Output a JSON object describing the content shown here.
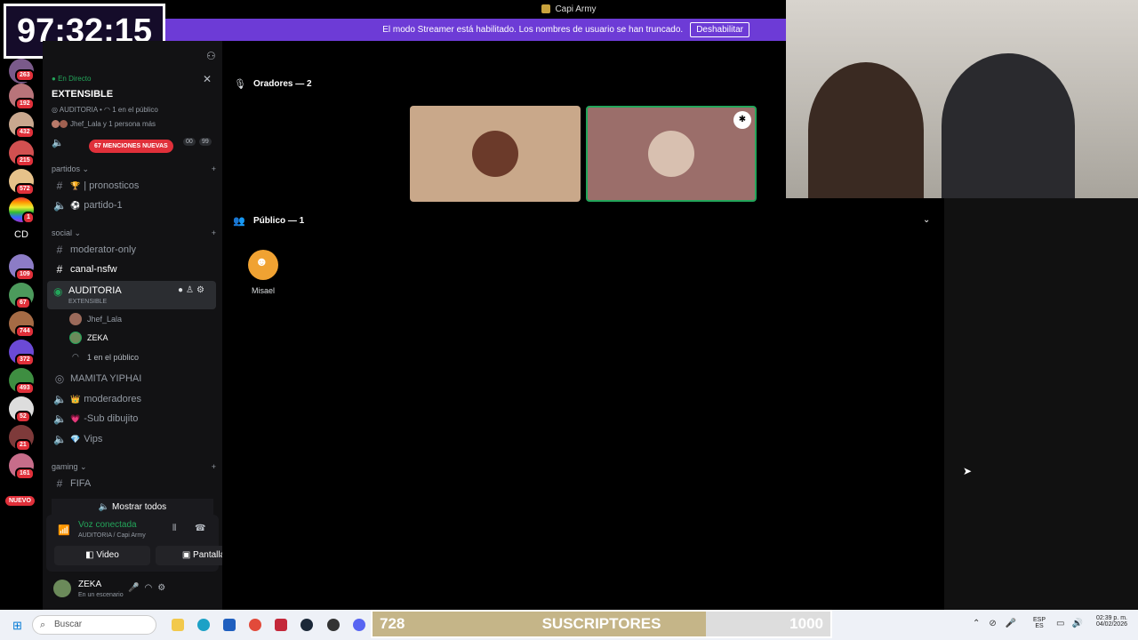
{
  "window": {
    "title": "Capi Army"
  },
  "streamer_bar": {
    "message": "El modo Streamer está habilitado. Los nombres de usuario se han truncado.",
    "button": "Deshabilitar"
  },
  "timer": "97:32:15",
  "server_rail": {
    "badges": [
      "263",
      "192",
      "432",
      "215",
      "572",
      "1",
      "109",
      "67",
      "744",
      "372",
      "493",
      "52",
      "21",
      "161"
    ],
    "dm_label": "CD",
    "new_label": "NUEVO"
  },
  "live_card": {
    "status": "En Directo",
    "title": "EXTENSIBLE",
    "channel": "AUDITORIA",
    "audience": "1 en el público",
    "members": "Jhef_Lala y 1 persona más"
  },
  "mentions": "67 MENCIONES NUEVAS",
  "mini_counts": [
    "00",
    "99"
  ],
  "categories": {
    "partidos": "partidos",
    "social": "social",
    "gaming": "gaming"
  },
  "channels": {
    "pronosticos": "| pronosticos",
    "partido1": "partido-1",
    "moderator_only": "moderator-only",
    "canal_nsfw": "canal-nsfw",
    "auditoria": "AUDITORIA",
    "auditoria_sub": "EXTENSIBLE",
    "user1": "Jhef_Lala",
    "user2": "ZEKA",
    "audience": "1 en el público",
    "mamita": "MAMITA YIPHAI",
    "moderadores": "moderadores",
    "sub_dibujito": "-Sub dibujito",
    "vips": "Vips",
    "fifa": "FIFA"
  },
  "show_all": "Mostrar todos",
  "voice": {
    "status": "Voz conectada",
    "location": "AUDITORIA / Capi Army",
    "video": "Video",
    "screen": "Pantalla"
  },
  "user": {
    "name": "ZEKA",
    "status": "En un escenario"
  },
  "stage": {
    "speakers": "Oradores — 2",
    "audience": "Público — 1",
    "audience_member": "Misael"
  },
  "taskbar": {
    "search": "Buscar",
    "lang": "ESP",
    "lang2": "ES",
    "time": "02:39 p. m.",
    "date": "04/02/2026"
  },
  "subgoal": {
    "current": "728",
    "label": "SUSCRIPTORES",
    "target": "1000",
    "progress": 0.728
  },
  "colors": {
    "accent": "#6d3bd6",
    "green": "#23a55a",
    "badge": "#e0303a"
  }
}
